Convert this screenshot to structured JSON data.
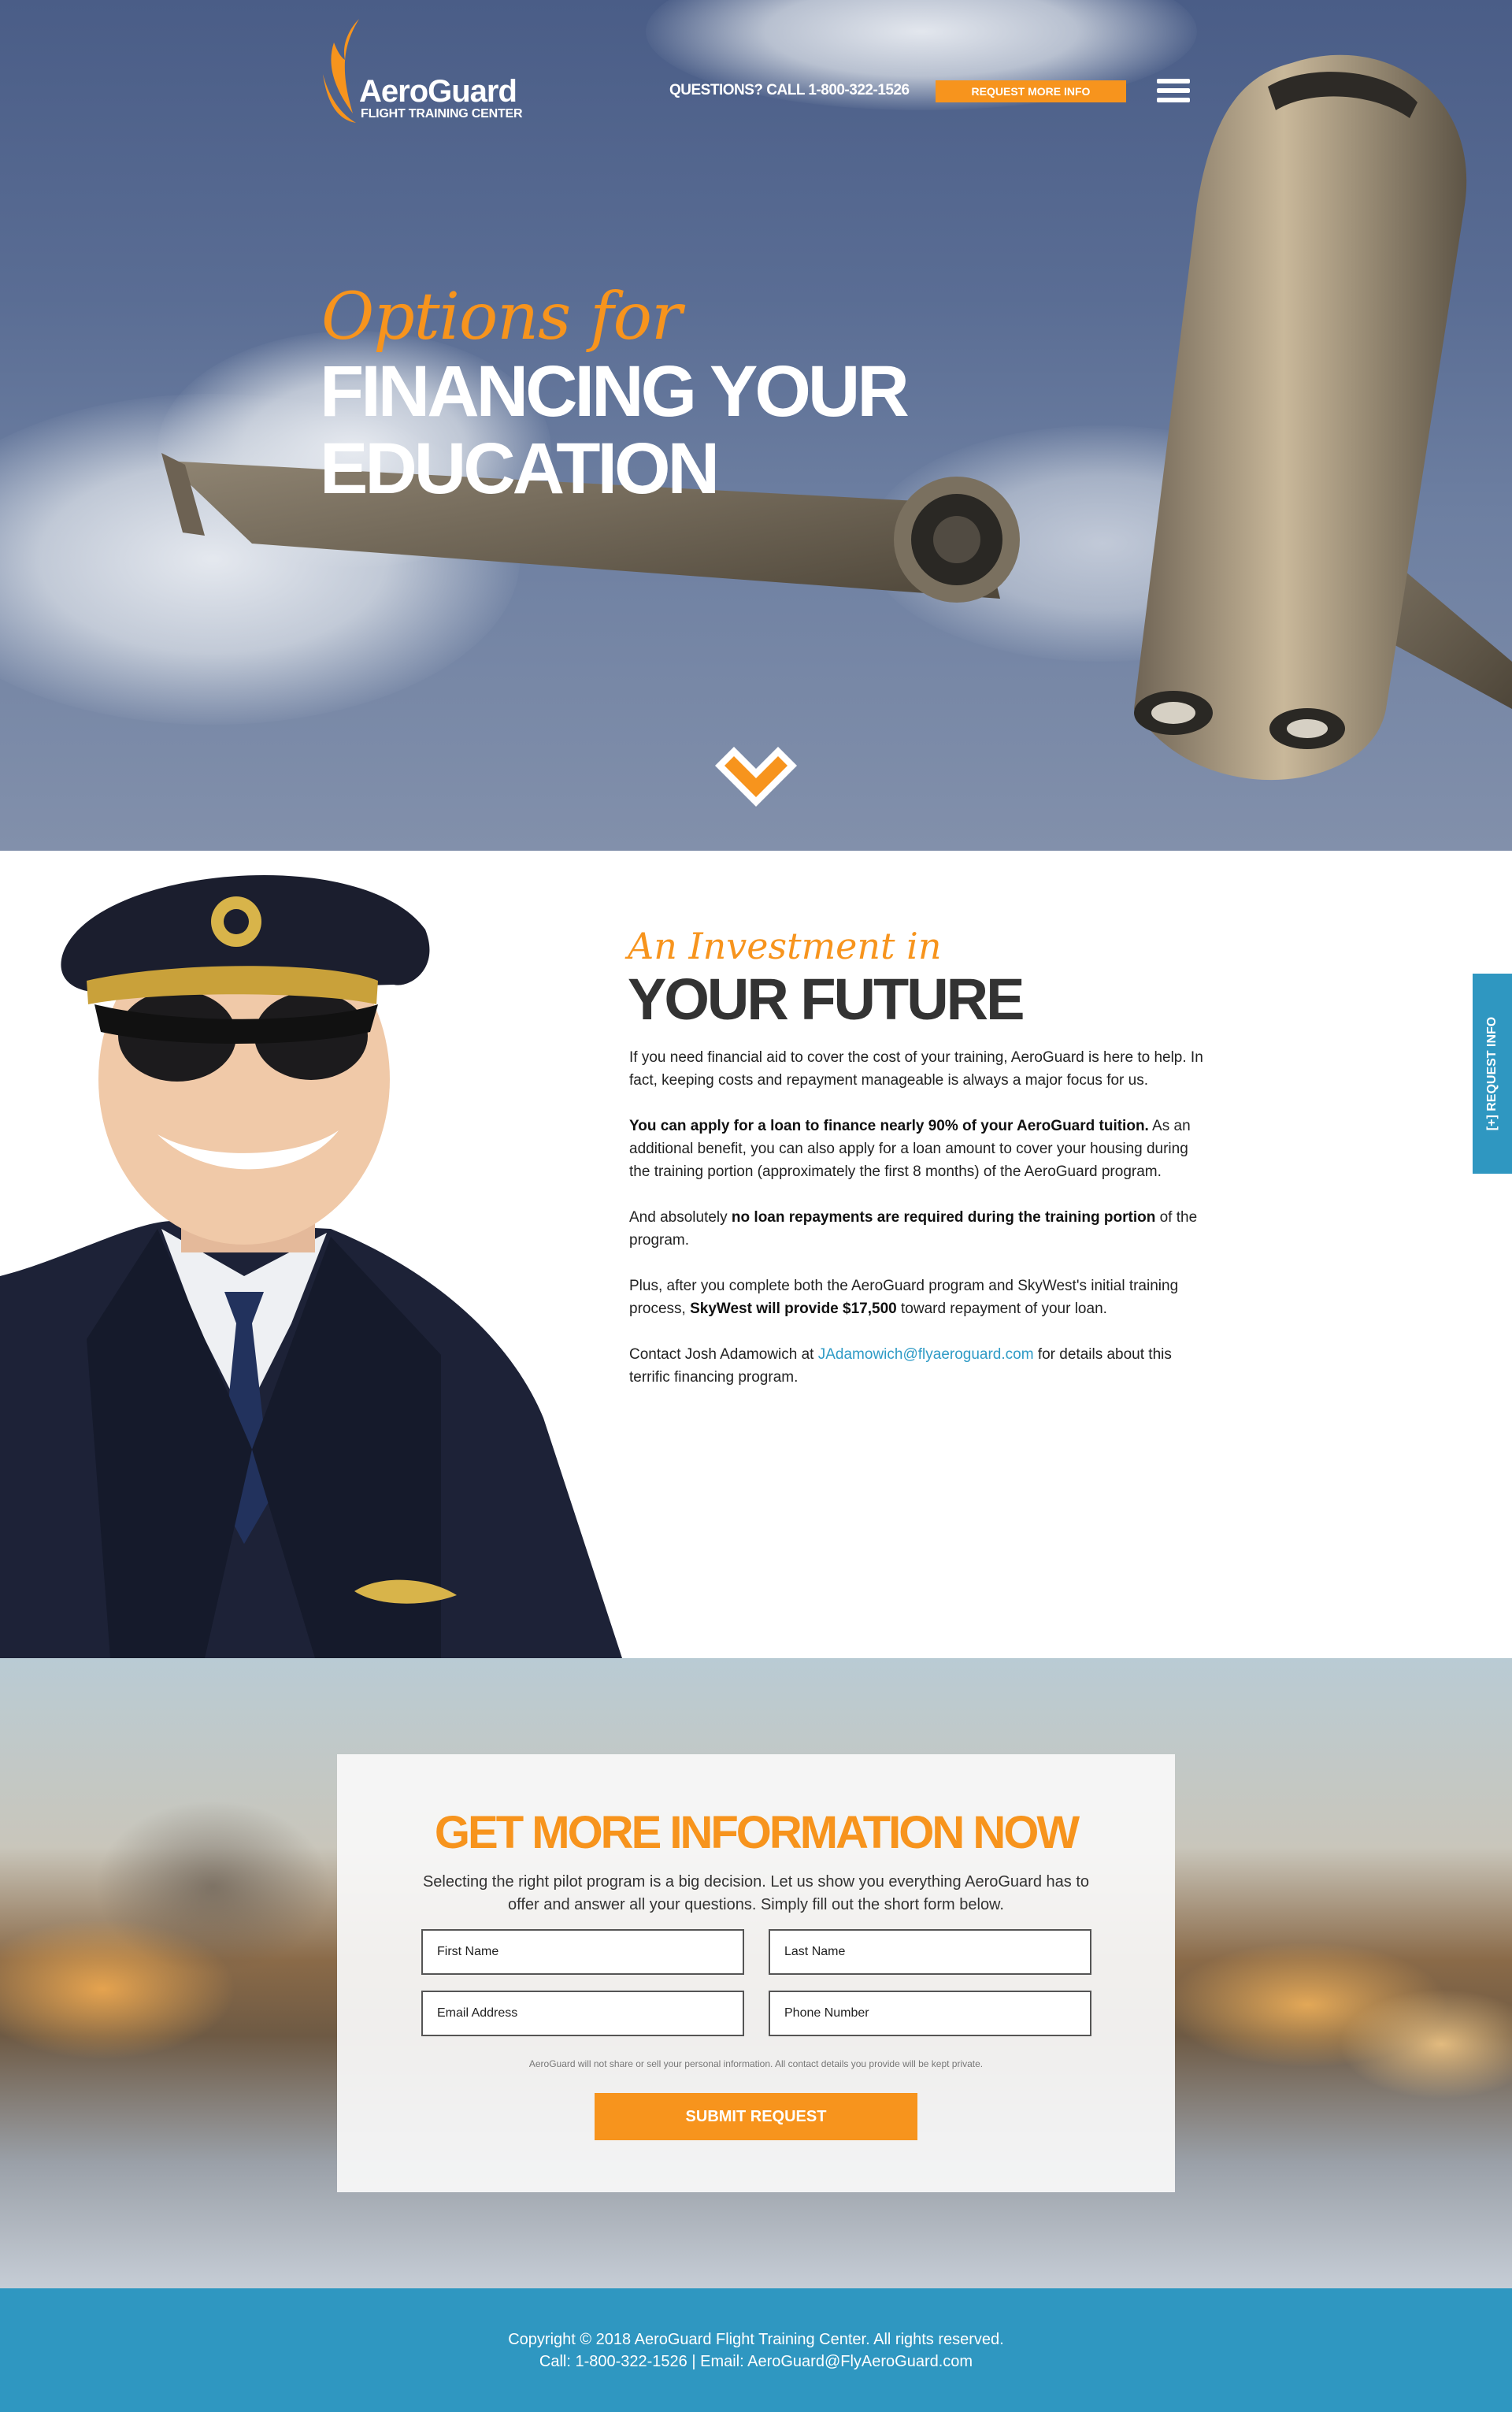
{
  "brand": {
    "name": "AeroGuard",
    "subtitle": "FLIGHT TRAINING CENTER"
  },
  "header": {
    "phone_text": "QUESTIONS? CALL 1-800-322-1526",
    "request_button": "REQUEST MORE INFO",
    "menu_icon": "hamburger-menu-icon"
  },
  "hero": {
    "kicker": "Options for",
    "title_line1": "FINANCING YOUR",
    "title_line2": "EDUCATION",
    "scroll_icon": "chevron-down-icon"
  },
  "investment": {
    "kicker": "An Investment in",
    "title": "YOUR FUTURE",
    "p1": "If you need financial aid to cover the cost of your training, AeroGuard is here to help. In fact, keeping costs and repayment manageable is always a major focus for us.",
    "p2_bold": "You can apply for a loan to finance nearly 90% of your AeroGuard tuition.",
    "p2_rest": " As an additional benefit, you can also apply for a loan amount to cover your housing during the training portion (approximately the first 8 months) of the AeroGuard program.",
    "p3_pre": "And absolutely ",
    "p3_bold": "no loan repayments are required during the training portion",
    "p3_post": " of the program.",
    "p4_pre": "Plus, after you complete both the AeroGuard program and SkyWest's initial training process, ",
    "p4_bold": "SkyWest will provide $17,500",
    "p4_post": " toward repayment of your loan.",
    "p5_pre": "Contact Josh Adamowich at ",
    "p5_link": "JAdamowich@flyaeroguard.com",
    "p5_post": " for details about this terrific financing program."
  },
  "side_tab": {
    "label": "[+] REQUEST INFO"
  },
  "form": {
    "title": "GET MORE INFORMATION NOW",
    "subtitle": "Selecting the right pilot program is a big decision. Let us show you everything AeroGuard has to offer and answer all your questions.  Simply fill out the short form below.",
    "first_name": "First Name",
    "last_name": "Last Name",
    "email": "Email Address",
    "phone": "Phone Number",
    "privacy": "AeroGuard will not share or sell your personal information. All contact details you provide will be kept private.",
    "submit": "SUBMIT REQUEST"
  },
  "footer": {
    "copyright": "Copyright © 2018 AeroGuard Flight Training Center. All rights reserved.",
    "contact": "Call:  1-800-322-1526  |  Email: AeroGuard@FlyAeroGuard.com"
  },
  "colors": {
    "accent": "#f7941d",
    "footer_blue": "#2f97c1",
    "link_blue": "#2f9bc6"
  }
}
